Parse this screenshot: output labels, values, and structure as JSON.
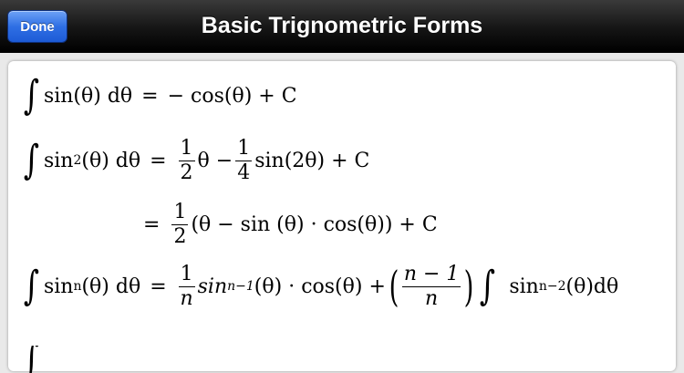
{
  "nav": {
    "done_label": "Done",
    "title": "Basic Trignometric Forms"
  },
  "equations": {
    "eq1": {
      "lhs": "sin(θ) dθ",
      "rhs": "− cos(θ) + C"
    },
    "eq2": {
      "lhs_fn": "sin",
      "lhs_sup": "2",
      "lhs_rest": "(θ) dθ",
      "f1_num": "1",
      "f1_den": "2",
      "mid": "θ −",
      "f2_num": "1",
      "f2_den": "4",
      "tail": "sin(2θ) + C"
    },
    "eq3": {
      "f_num": "1",
      "f_den": "2",
      "tail": "(θ − sin (θ) · cos(θ)) + C"
    },
    "eq4": {
      "lhs_fn": "sin",
      "lhs_sup": "n",
      "lhs_rest": "(θ) dθ",
      "f1_num": "1",
      "f1_den": "n",
      "mid_fn": "sin",
      "mid_sup": "n−1",
      "mid_rest": "(θ) · cos(θ) +",
      "f2_num": "n − 1",
      "f2_den": "n",
      "int_fn": "sin",
      "int_sup": "n−2",
      "int_rest": "(θ)dθ"
    }
  }
}
